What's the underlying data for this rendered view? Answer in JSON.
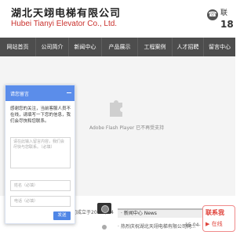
{
  "header": {
    "company_cn": "湖北天翊电梯有限公司",
    "company_en": "Hubei Tianyi Elevator Co., Ltd.",
    "phone_label": "联",
    "phone_number": "18",
    "phone_icon": "phone-icon"
  },
  "nav": {
    "items": [
      {
        "label": "网站首页"
      },
      {
        "label": "公司简介"
      },
      {
        "label": "新闻中心"
      },
      {
        "label": "产品展示"
      },
      {
        "label": "工程案例"
      },
      {
        "label": "人才招聘"
      },
      {
        "label": "留言中心"
      }
    ]
  },
  "flash": {
    "message": "Adobe Flash Player 已不再受支持",
    "icon": "plugin-puzzle-icon"
  },
  "dialog": {
    "title": "请您留言",
    "message": "感谢您的关注，当前客服人员不在线，请填写一下您的信息，我们会尽快和您联系。",
    "textarea_placeholder": "请在此输入留言内容，我们会尽快与您联系。（必填）",
    "name_placeholder": "姓名（必填）",
    "phone_placeholder": "电话（必填）",
    "send_label": "发送"
  },
  "bottom": {
    "left_news": "司成立于2014年04",
    "news_tab": "· 新闻中心 News",
    "news_line": "· 热烈庆祝湖北天翊电梯有限公司网...",
    "news_date": "15-04-",
    "contact_label": "联系我",
    "contact_icon_text": "▶ 在线"
  },
  "colors": {
    "nav_bg": "#4d4d4d",
    "dialog_header": "#5b8dea",
    "accent_red": "#c9302c"
  }
}
